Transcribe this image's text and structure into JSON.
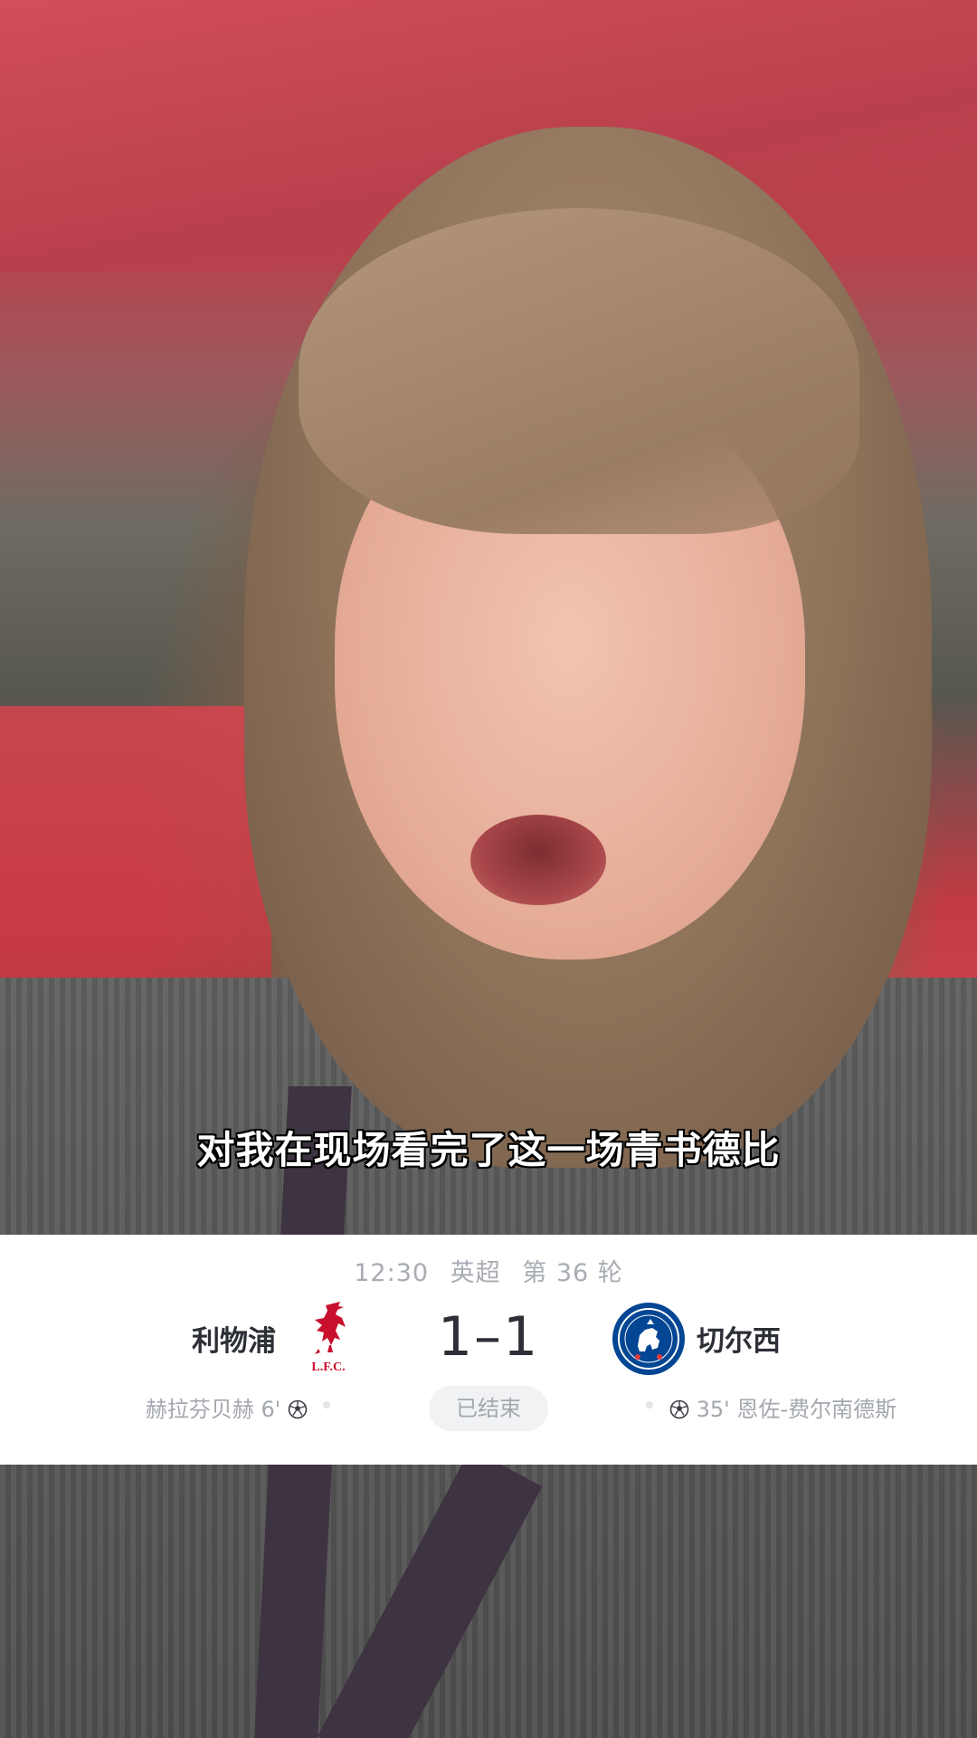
{
  "video": {
    "subtitle": "对我在现场看完了这一场青书德比"
  },
  "match": {
    "time": "12:30",
    "league": "英超",
    "round": "第 36 轮",
    "home_team": "利物浦",
    "away_team": "切尔西",
    "score": "1–1",
    "status": "已结束",
    "home_scorer": "赫拉芬贝赫 6'",
    "away_scorer": "35' 恩佐-费尔南德斯",
    "home_crest_text": "L.F.C.",
    "away_crest_text": "CHELSEA FOOTBALL CLUB",
    "colors": {
      "home_crest": "#c8102e",
      "away_crest": "#034694",
      "text_primary": "#2c2f36",
      "text_secondary": "#a3a7ae"
    },
    "icons": {
      "goal": "soccer-ball-icon"
    }
  }
}
